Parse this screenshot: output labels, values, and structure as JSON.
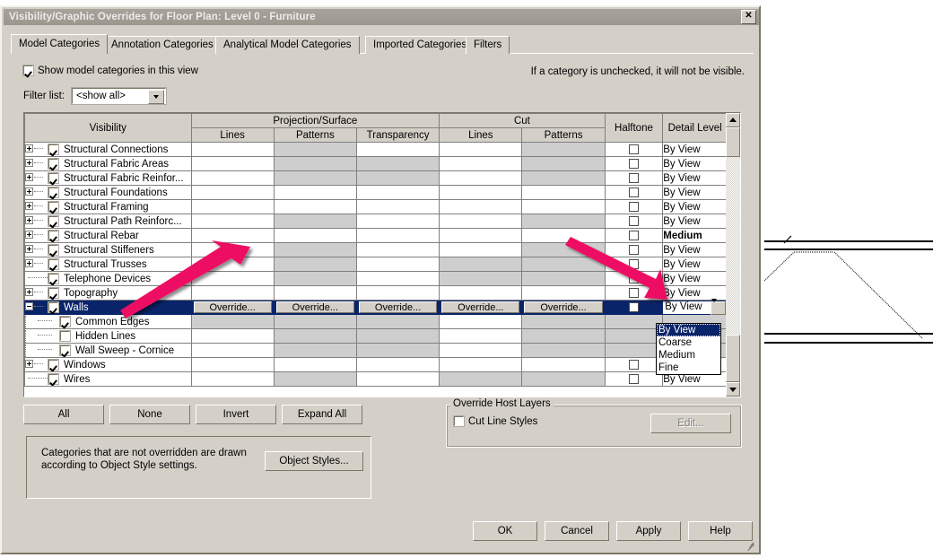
{
  "window": {
    "title": "Visibility/Graphic Overrides for Floor Plan: Level 0 - Furniture",
    "close_label": "✕"
  },
  "tabs": [
    {
      "label": "Model Categories",
      "selected": true
    },
    {
      "label": "Annotation Categories",
      "selected": false
    },
    {
      "label": "Analytical Model Categories",
      "selected": false
    },
    {
      "label": "Imported Categories",
      "selected": false
    },
    {
      "label": "Filters",
      "selected": false
    }
  ],
  "options": {
    "show_model_categories_label": "Show model categories in this view",
    "show_model_categories_checked": true,
    "unchecked_note": "If a category is unchecked, it will not be visible.",
    "filter_list_label": "Filter list:",
    "filter_list_value": "<show all>"
  },
  "table": {
    "headers": {
      "visibility": "Visibility",
      "projection_surface": "Projection/Surface",
      "cut": "Cut",
      "halftone": "Halftone",
      "detail_level": "Detail Level",
      "lines": "Lines",
      "patterns": "Patterns",
      "transparency": "Transparency",
      "cut_lines": "Lines",
      "cut_patterns": "Patterns"
    },
    "override_label": "Override...",
    "rows": [
      {
        "name": "Structural Connections",
        "expandable": true,
        "checked": true,
        "indent": 0,
        "ps_lines": "empty",
        "ps_patterns": "hatch",
        "ps_transparency": "empty",
        "cut_lines": "empty",
        "cut_patterns": "hatch",
        "halftone": "checkbox",
        "detail": "By View",
        "bold": false
      },
      {
        "name": "Structural Fabric Areas",
        "expandable": true,
        "checked": true,
        "indent": 0,
        "ps_lines": "empty",
        "ps_patterns": "hatch",
        "ps_transparency": "hatch",
        "cut_lines": "empty",
        "cut_patterns": "hatch",
        "halftone": "checkbox",
        "detail": "By View",
        "bold": false
      },
      {
        "name": "Structural Fabric Reinfor...",
        "expandable": true,
        "checked": true,
        "indent": 0,
        "ps_lines": "empty",
        "ps_patterns": "hatch",
        "ps_transparency": "hatch",
        "cut_lines": "empty",
        "cut_patterns": "hatch",
        "halftone": "checkbox",
        "detail": "By View",
        "bold": false
      },
      {
        "name": "Structural Foundations",
        "expandable": true,
        "checked": true,
        "indent": 0,
        "ps_lines": "empty",
        "ps_patterns": "empty",
        "ps_transparency": "empty",
        "cut_lines": "empty",
        "cut_patterns": "empty",
        "halftone": "checkbox",
        "detail": "By View",
        "bold": false
      },
      {
        "name": "Structural Framing",
        "expandable": true,
        "checked": true,
        "indent": 0,
        "ps_lines": "empty",
        "ps_patterns": "empty",
        "ps_transparency": "empty",
        "cut_lines": "empty",
        "cut_patterns": "empty",
        "halftone": "checkbox",
        "detail": "By View",
        "bold": false
      },
      {
        "name": "Structural Path Reinforc...",
        "expandable": true,
        "checked": true,
        "indent": 0,
        "ps_lines": "empty",
        "ps_patterns": "hatch",
        "ps_transparency": "empty",
        "cut_lines": "empty",
        "cut_patterns": "hatch",
        "halftone": "checkbox",
        "detail": "By View",
        "bold": false
      },
      {
        "name": "Structural Rebar",
        "expandable": true,
        "checked": true,
        "indent": 0,
        "ps_lines": "empty",
        "ps_patterns": "empty",
        "ps_transparency": "empty",
        "cut_lines": "empty",
        "cut_patterns": "empty",
        "halftone": "checkbox",
        "detail": "Medium",
        "bold": true
      },
      {
        "name": "Structural Stiffeners",
        "expandable": true,
        "checked": true,
        "indent": 0,
        "ps_lines": "empty",
        "ps_patterns": "hatch",
        "ps_transparency": "empty",
        "cut_lines": "empty",
        "cut_patterns": "hatch",
        "halftone": "checkbox",
        "detail": "By View",
        "bold": false
      },
      {
        "name": "Structural Trusses",
        "expandable": true,
        "checked": true,
        "indent": 0,
        "ps_lines": "empty",
        "ps_patterns": "hatch",
        "ps_transparency": "empty",
        "cut_lines": "hatch",
        "cut_patterns": "hatch",
        "halftone": "checkbox",
        "detail": "By View",
        "bold": false
      },
      {
        "name": "Telephone Devices",
        "expandable": false,
        "checked": true,
        "indent": 0,
        "ps_lines": "empty",
        "ps_patterns": "hatch",
        "ps_transparency": "empty",
        "cut_lines": "hatch",
        "cut_patterns": "hatch",
        "halftone": "checkbox",
        "detail": "By View",
        "bold": false
      },
      {
        "name": "Topography",
        "expandable": true,
        "checked": true,
        "indent": 0,
        "ps_lines": "empty",
        "ps_patterns": "empty",
        "ps_transparency": "empty",
        "cut_lines": "empty",
        "cut_patterns": "empty",
        "halftone": "checkbox",
        "detail": "By View",
        "bold": false
      },
      {
        "name": "Walls",
        "expandable": true,
        "expanded": true,
        "checked": true,
        "indent": 0,
        "selected": true,
        "ps_lines": "override",
        "ps_patterns": "override",
        "ps_transparency": "override",
        "cut_lines": "override",
        "cut_patterns": "override",
        "halftone": "checkbox",
        "detail": "By View",
        "bold": false
      },
      {
        "name": "Common Edges",
        "expandable": false,
        "checked": true,
        "indent": 1,
        "ps_lines": "hatch",
        "ps_patterns": "hatch",
        "ps_transparency": "hatch",
        "cut_lines": "empty",
        "cut_patterns": "hatch",
        "halftone": "hatch",
        "detail": "hatch",
        "bold": false
      },
      {
        "name": "Hidden Lines",
        "expandable": false,
        "checked": false,
        "indent": 1,
        "ps_lines": "empty",
        "ps_patterns": "hatch",
        "ps_transparency": "hatch",
        "cut_lines": "empty",
        "cut_patterns": "hatch",
        "halftone": "hatch",
        "detail": "hatch",
        "bold": false
      },
      {
        "name": "Wall Sweep - Cornice",
        "expandable": false,
        "checked": true,
        "indent": 1,
        "ps_lines": "empty",
        "ps_patterns": "hatch",
        "ps_transparency": "hatch",
        "cut_lines": "empty",
        "cut_patterns": "hatch",
        "halftone": "hatch",
        "detail": "hatch",
        "bold": false
      },
      {
        "name": "Windows",
        "expandable": true,
        "checked": true,
        "indent": 0,
        "ps_lines": "empty",
        "ps_patterns": "empty",
        "ps_transparency": "empty",
        "cut_lines": "empty",
        "cut_patterns": "empty",
        "halftone": "checkbox",
        "detail": "By View",
        "bold": false
      },
      {
        "name": "Wires",
        "expandable": false,
        "checked": true,
        "indent": 0,
        "ps_lines": "empty",
        "ps_patterns": "hatch",
        "ps_transparency": "empty",
        "cut_lines": "hatch",
        "cut_patterns": "hatch",
        "halftone": "checkbox",
        "detail": "By View",
        "bold": false
      }
    ]
  },
  "detail_level_dropdown": {
    "selected": "By View",
    "options": [
      "By View",
      "Coarse",
      "Medium",
      "Fine"
    ]
  },
  "buttons": {
    "all": "All",
    "none": "None",
    "invert": "Invert",
    "expand_all": "Expand All",
    "object_styles": "Object Styles...",
    "edit": "Edit...",
    "ok": "OK",
    "cancel": "Cancel",
    "apply": "Apply",
    "help": "Help"
  },
  "note": {
    "line1": "Categories that are not overridden are drawn",
    "line2": "according to Object Style settings."
  },
  "override_host_layers": {
    "legend": "Override Host Layers",
    "cut_line_styles_label": "Cut Line Styles",
    "cut_line_styles_checked": false
  },
  "annotations": {
    "arrow_color": "#ed1164",
    "arrow_left_name": "arrow-pointing-to-walls-row",
    "arrow_right_name": "arrow-pointing-to-detail-level"
  }
}
